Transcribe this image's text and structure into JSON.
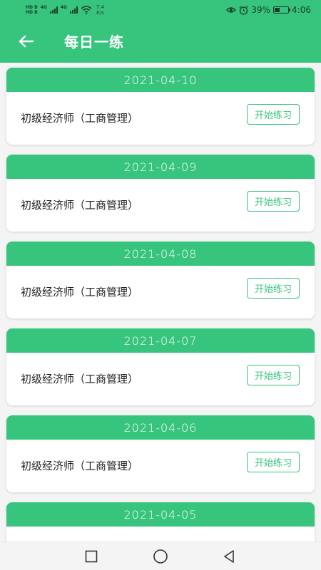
{
  "status_bar": {
    "hd1": "HD",
    "hd2": "HD",
    "sim1": "B",
    "sim2": "B",
    "net1": "4G",
    "net2": "4G",
    "speed_value": "7.4",
    "speed_unit": "K/s",
    "battery": "39%",
    "battery_level": 0.39,
    "time": "4:06"
  },
  "app_bar": {
    "title": "每日一练"
  },
  "practice_list": [
    {
      "date": "2021-04-10",
      "course": "初级经济师（工商管理）",
      "button": "开始练习"
    },
    {
      "date": "2021-04-09",
      "course": "初级经济师（工商管理）",
      "button": "开始练习"
    },
    {
      "date": "2021-04-08",
      "course": "初级经济师（工商管理）",
      "button": "开始练习"
    },
    {
      "date": "2021-04-07",
      "course": "初级经济师（工商管理）",
      "button": "开始练习"
    },
    {
      "date": "2021-04-06",
      "course": "初级经济师（工商管理）",
      "button": "开始练习"
    },
    {
      "date": "2021-04-05",
      "course": "",
      "button": ""
    }
  ],
  "colors": {
    "primary": "#37c47c",
    "background": "#f4f4f4",
    "card": "#ffffff",
    "text": "#222222"
  },
  "icons": {
    "back": "arrow-left-icon",
    "recent": "square-icon",
    "home": "circle-icon",
    "nav_back": "triangle-left-icon"
  }
}
